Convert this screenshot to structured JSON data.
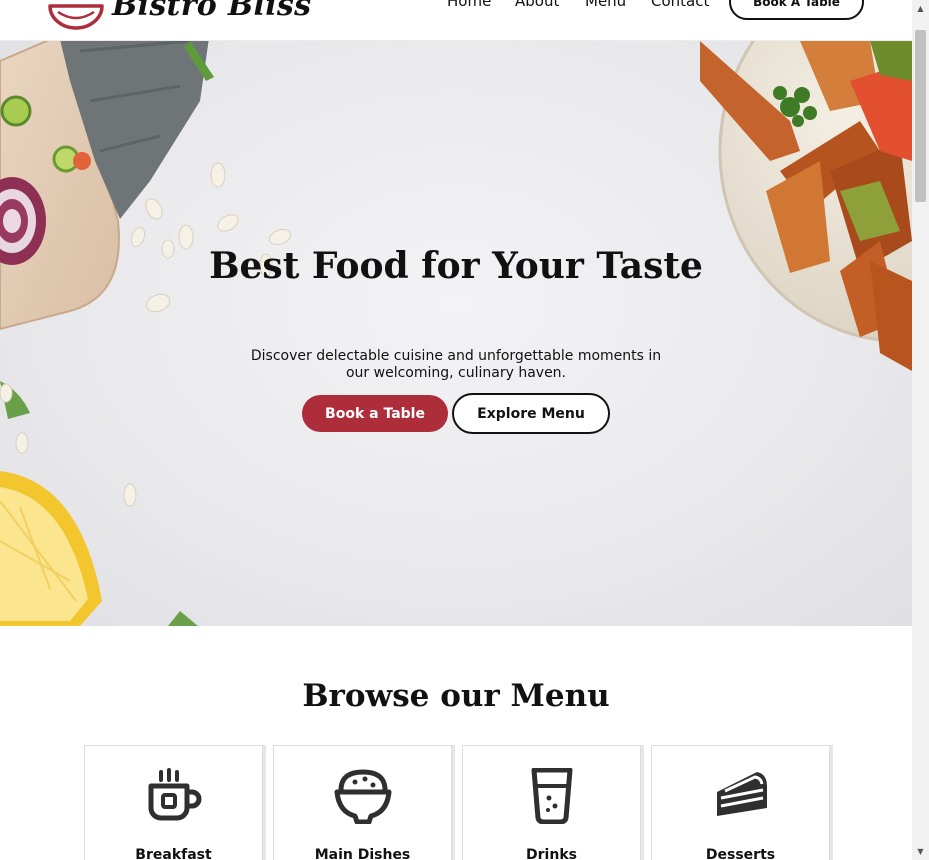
{
  "header": {
    "brand": "Bistro Bliss",
    "logo_icon": "bowl-icon",
    "nav": [
      "Home",
      "About",
      "Menu",
      "Contact"
    ],
    "cta_label": "Book A Table"
  },
  "hero": {
    "title": "Best Food for Your Taste",
    "subtitle": "Discover delectable cuisine and unforgettable moments in our welcoming, culinary haven.",
    "primary_button": "Book a Table",
    "secondary_button": "Explore Menu"
  },
  "menu": {
    "title": "Browse our Menu",
    "categories": [
      {
        "label": "Breakfast",
        "icon": "coffee-cup-icon"
      },
      {
        "label": "Main Dishes",
        "icon": "rice-bowl-icon"
      },
      {
        "label": "Drinks",
        "icon": "glass-icon"
      },
      {
        "label": "Desserts",
        "icon": "cake-slice-icon"
      }
    ]
  },
  "colors": {
    "accent": "#ad2d3b",
    "text": "#111111",
    "hero_background": "#ebebee"
  }
}
